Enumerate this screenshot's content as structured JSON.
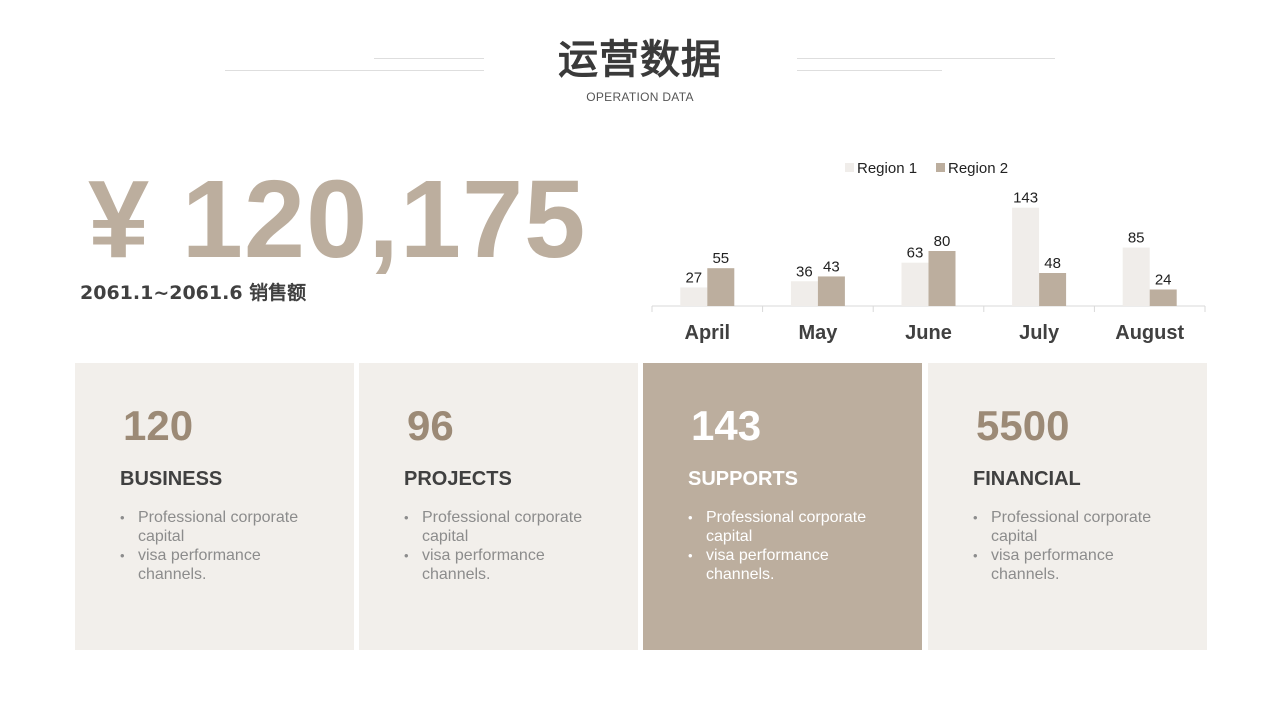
{
  "header": {
    "title": "运营数据",
    "subtitle": "OPERATION DATA"
  },
  "summary": {
    "amount": "¥ 120,175",
    "period_label": "2061.1~2061.6 销售额"
  },
  "colors": {
    "accent": "#bcae9e",
    "accent_dark": "#9c8a76",
    "panel": "#f2efeb",
    "region1": "#f0edea",
    "region2": "#bcae9e"
  },
  "chart_data": {
    "type": "bar",
    "categories": [
      "April",
      "May",
      "June",
      "July",
      "August"
    ],
    "series": [
      {
        "name": "Region 1",
        "values": [
          27,
          36,
          63,
          143,
          85
        ]
      },
      {
        "name": "Region 2",
        "values": [
          55,
          43,
          80,
          48,
          24
        ]
      }
    ],
    "legend": "top",
    "grid": false,
    "ylim": [
      0,
      160
    ]
  },
  "cards": [
    {
      "value": "120",
      "label": "BUSINESS",
      "bullets": [
        "Professional corporate capital",
        "visa performance channels."
      ]
    },
    {
      "value": "96",
      "label": "PROJECTS",
      "bullets": [
        "Professional corporate capital",
        "visa performance channels."
      ]
    },
    {
      "value": "143",
      "label": "SUPPORTS",
      "bullets": [
        "Professional corporate capital",
        "visa performance channels."
      ]
    },
    {
      "value": "5500",
      "label": "FINANCIAL",
      "bullets": [
        "Professional corporate capital",
        "visa performance channels."
      ]
    }
  ]
}
